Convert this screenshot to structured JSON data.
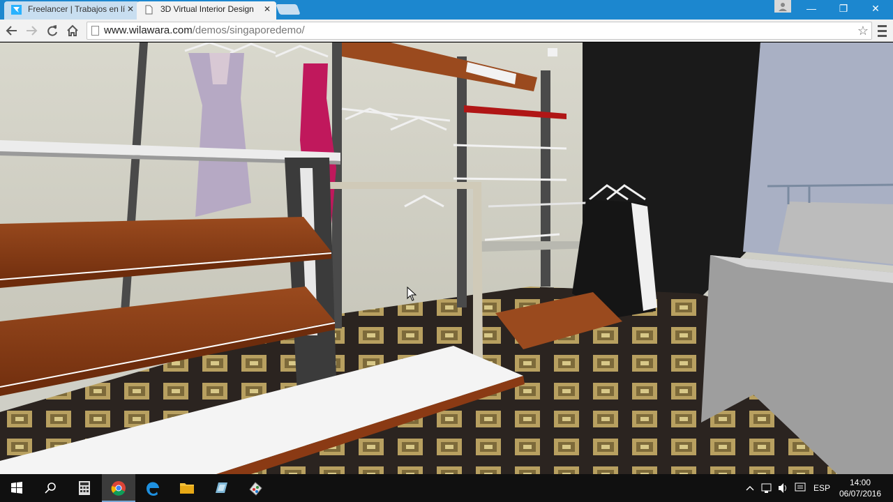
{
  "browser": {
    "tabs": [
      {
        "title": "Freelancer | Trabajos en lí",
        "active": false
      },
      {
        "title": "3D Virtual Interior Design",
        "active": true
      }
    ],
    "tab_close_glyph": "✕",
    "window_controls": {
      "minimize": "—",
      "maximize": "❐",
      "close": "✕"
    },
    "address_bar": {
      "domain": "www.wilawara.com",
      "path": "/demos/singaporedemo/"
    },
    "bookmark_star": "☆"
  },
  "taskbar": {
    "apps": [
      "start-icon",
      "search-icon",
      "calculator-icon",
      "chrome-icon",
      "edge-icon",
      "file-explorer-icon",
      "app-icon",
      "paint-icon"
    ],
    "tray": {
      "chevron": "^",
      "language": "ESP",
      "time": "14:00",
      "date": "06/07/2016"
    }
  },
  "colors": {
    "tabstrip": "#1c87cf",
    "wood": "#8a3a14",
    "carpet_gold": "#b8a060",
    "wall": "#cfcfc6",
    "dark_wall": "#1a1a1a"
  }
}
